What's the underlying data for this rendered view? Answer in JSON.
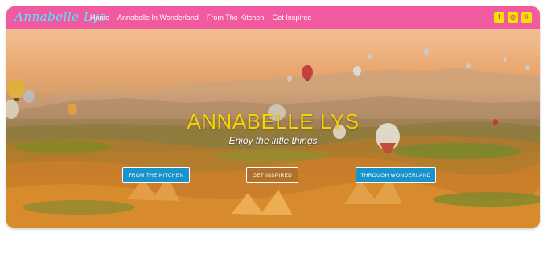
{
  "header": {
    "logo_text": "Annabelle Lys",
    "nav": [
      "Home",
      "Annabelle In Wonderland",
      "From The Kitchen",
      "Get Inspired"
    ],
    "social": [
      {
        "icon": "facebook-icon",
        "glyph": "f"
      },
      {
        "icon": "instagram-icon",
        "glyph": "◎"
      },
      {
        "icon": "pinterest-icon",
        "glyph": "℗"
      }
    ]
  },
  "hero": {
    "title": "ANNABELLE LYS",
    "tagline": "Enjoy the little things",
    "buttons": [
      "FROM THE KITCHEN",
      "GET INSPIRED",
      "THROUGH WONDERLAND"
    ]
  },
  "colors": {
    "navbar": "#f25aa0",
    "title": "#f5d400",
    "button_blue": "#1a92cc",
    "social_bg": "#f5e200"
  }
}
